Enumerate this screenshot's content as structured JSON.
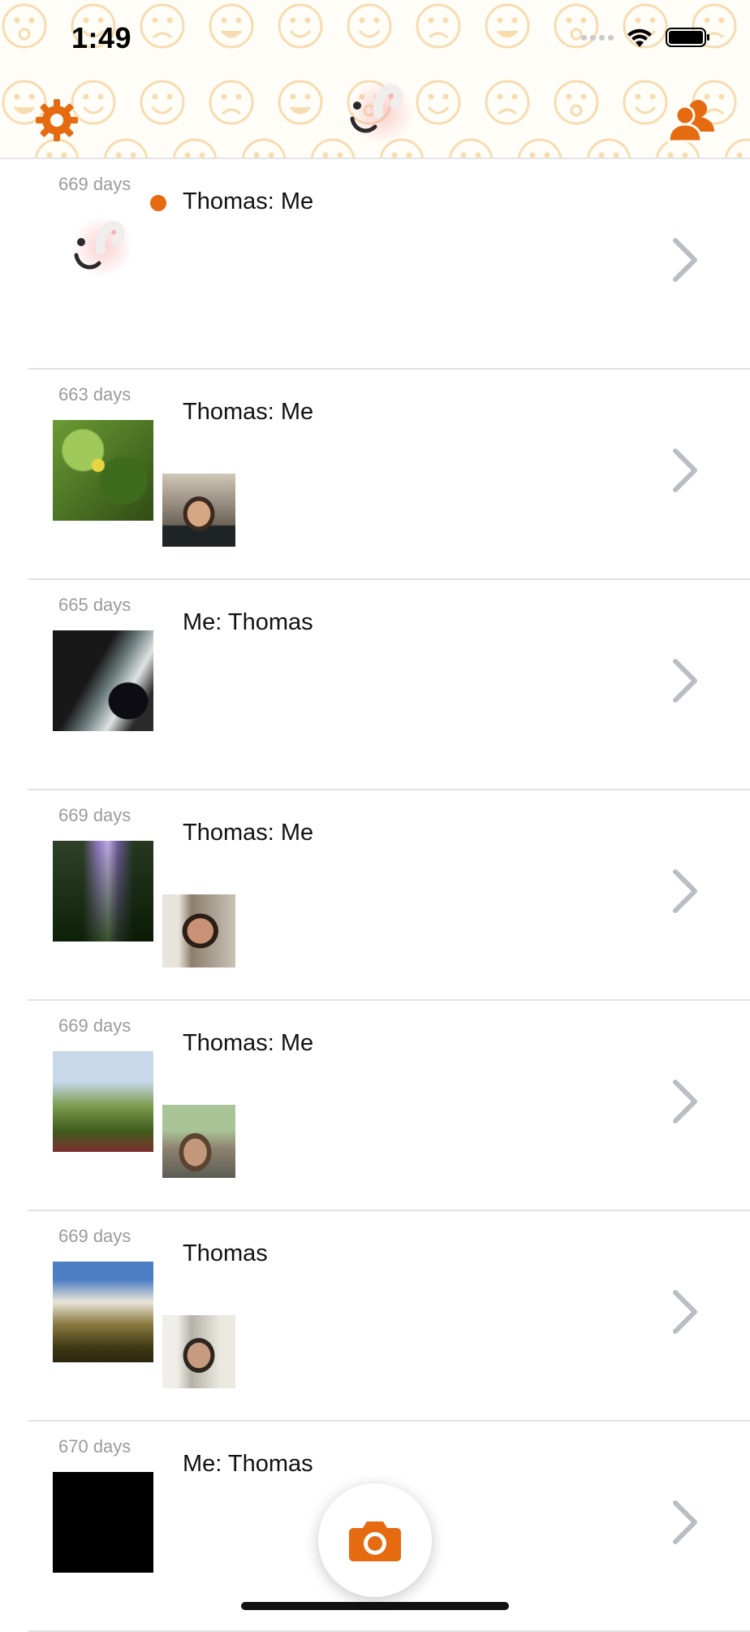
{
  "status_bar": {
    "time": "1:49"
  },
  "header": {
    "left_icon": "gear-icon",
    "center_icon": "app-logo",
    "right_icon": "friends-icon",
    "accent_color": "#e66a10"
  },
  "conversations": [
    {
      "days": "669 days",
      "title": "Thomas: Me",
      "unread": true,
      "thumb": "logo",
      "small": null
    },
    {
      "days": "663 days",
      "title": "Thomas: Me",
      "unread": false,
      "thumb": "p-leaves",
      "small": "p-face1"
    },
    {
      "days": "665 days",
      "title": "Me: Thomas",
      "unread": false,
      "thumb": "p-dark",
      "small": null
    },
    {
      "days": "669 days",
      "title": "Thomas: Me",
      "unread": false,
      "thumb": "p-waterfall",
      "small": "p-face2"
    },
    {
      "days": "669 days",
      "title": "Thomas: Me",
      "unread": false,
      "thumb": "p-flowers",
      "small": "p-face3"
    },
    {
      "days": "669 days",
      "title": "Thomas",
      "unread": false,
      "thumb": "p-falls2",
      "small": "p-face4"
    },
    {
      "days": "670 days",
      "title": "Me: Thomas",
      "unread": false,
      "thumb": "p-black",
      "small": null
    }
  ],
  "bottom": {
    "camera_icon": "camera-icon"
  }
}
